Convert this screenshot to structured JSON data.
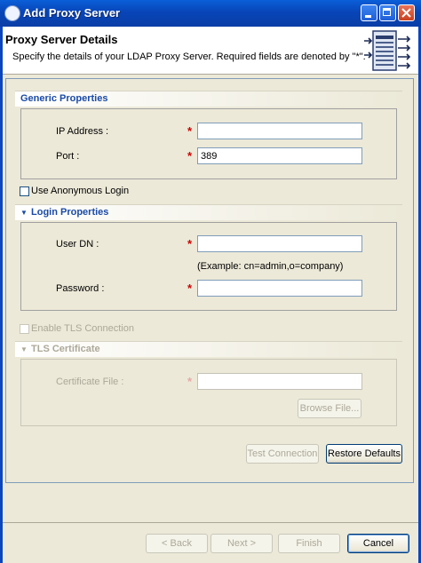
{
  "window": {
    "title": "Add Proxy Server"
  },
  "header": {
    "title": "Proxy Server Details",
    "description": "Specify the details of your LDAP Proxy Server. Required fields are denoted by \"*\"."
  },
  "generic": {
    "title": "Generic Properties",
    "ip_label": "IP Address :",
    "ip_value": "",
    "port_label": "Port :",
    "port_value": "389",
    "required_mark": "*"
  },
  "anonymous": {
    "label": "Use Anonymous Login",
    "checked": false
  },
  "login": {
    "title": "Login Properties",
    "user_dn_label": "User DN :",
    "user_dn_value": "",
    "example": "(Example: cn=admin,o=company)",
    "password_label": "Password :",
    "password_value": "",
    "required_mark": "*"
  },
  "tls": {
    "enable_label": "Enable TLS Connection",
    "cert_title": "TLS Certificate",
    "cert_file_label": "Certificate File :",
    "cert_file_value": "",
    "browse_label": "Browse File...",
    "required_mark": "*"
  },
  "actions": {
    "test_connection": "Test Connection",
    "restore_defaults": "Restore Defaults"
  },
  "wizard": {
    "back": "< Back",
    "next": "Next >",
    "finish": "Finish",
    "cancel": "Cancel"
  },
  "colors": {
    "titlebar": "#0a5fd8",
    "section_title": "#1a4aa7",
    "required": "#d00000"
  }
}
